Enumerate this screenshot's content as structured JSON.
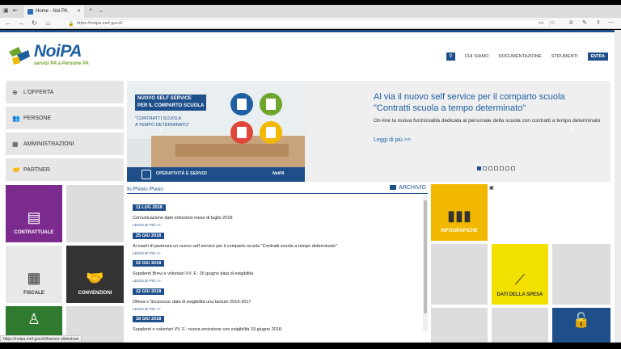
{
  "browser": {
    "tab_title": "Home - Noi PA",
    "url": "https://noipa.mef.gov.it/",
    "status_url": "https://noipa.mef.gov.it/#banner-slideshow"
  },
  "site": {
    "logo_name": "NoiPA",
    "logo_tagline": "servizi PA a Persone PA",
    "nav": [
      "CHI SIAMO",
      "DOCUMENTAZIONE",
      "STRUMENTI"
    ],
    "login_label": "ENTRA"
  },
  "menu": [
    {
      "label": "L'OFFERTA",
      "icon": "plus-circle-icon"
    },
    {
      "label": "PERSONE",
      "icon": "people-icon"
    },
    {
      "label": "AMMINISTRAZIONI",
      "icon": "building-icon"
    },
    {
      "label": "PARTNER",
      "icon": "handshake-icon"
    }
  ],
  "slide": {
    "image_title_1": "NUOVO SELF SERVICE",
    "image_title_2": "PER IL COMPARTO SCUOLA",
    "image_quote_1": "\"CONTRATTI SCUOLA",
    "image_quote_2": "A TEMPO DETERMINATO\"",
    "image_band": "OPERATIVITÀ E SERVIZI",
    "image_logo": "NoiPA",
    "title": "Al via il nuovo self service per il comparto scuola \"Contratti scuola a tempo determinato\"",
    "description": "On-line la nuova funzionalità dedicata al personale della scuola con contratti a tempo determinato",
    "more": "Leggi di più >>",
    "dots_total": 7,
    "dots_active": 1
  },
  "tiles": {
    "contrattuale": "CONTRATTUALE",
    "fiscale": "FISCALE",
    "convenzioni": "CONVENZIONI",
    "infografiche": "INFOGRAFICHE",
    "dati_spesa": "DATI DELLA SPESA"
  },
  "news": {
    "title": "In Primo Piano",
    "archive": "ARCHIVIO",
    "more_label": "LEGGI DI PIÙ >>",
    "items": [
      {
        "date": "11 LUG 2018",
        "text": "Comunicazione date emissioni mese di luglio 2018"
      },
      {
        "date": "25 GIU 2018",
        "text": "Ai nastri di partenza un nuovo self service per il comparto scuola \"Contratti scuola a tempo determinato\""
      },
      {
        "date": "22 GIU 2018",
        "text": "Supplenti Brevi e volontari VV. F.: 26 giugno data di esigibilità"
      },
      {
        "date": "22 GIU 2018",
        "text": "Difesa e Sicurezza: data di esigibilità una tantum 2016-2017"
      },
      {
        "date": "18 GIU 2018",
        "text": "Supplenti e volontari VV. F.: nuova emissione con esigibilità 19 giugno 2018."
      }
    ]
  },
  "colors": {
    "brand_blue": "#1e4f8a",
    "purple": "#7b2a8e",
    "yellow": "#f2b800",
    "green": "#2f7a2f",
    "dark": "#333333"
  }
}
